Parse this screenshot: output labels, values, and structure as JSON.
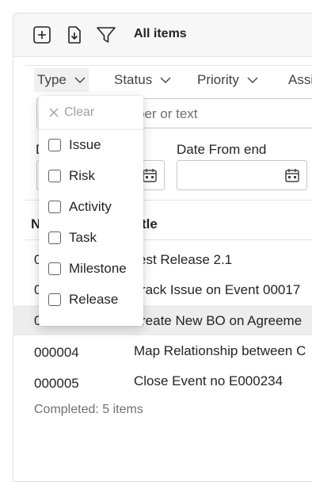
{
  "toolbar": {
    "title": "All items",
    "icons": [
      "add-icon",
      "import-icon",
      "filter-icon"
    ]
  },
  "filters": {
    "chips": [
      "Type",
      "Status",
      "Priority",
      "Assi"
    ],
    "search_placeholder": "ber or text",
    "date_from_start_label": "D",
    "date_from_end_label": "Date From end"
  },
  "table": {
    "headers": {
      "number": "N",
      "title": "tle"
    },
    "rows": [
      {
        "number": "0",
        "title": "est Release 2.1"
      },
      {
        "number": "0",
        "title": "rack Issue on Event 00017"
      },
      {
        "number": "0",
        "title": "reate New BO on Agreeme"
      },
      {
        "number": "000004",
        "title": "Map Relationship between C"
      },
      {
        "number": "000005",
        "title": "Close Event no E000234"
      }
    ],
    "footer": "Completed: 5 items"
  },
  "type_dropdown": {
    "clear_label": "Clear",
    "options": [
      "Issue",
      "Risk",
      "Activity",
      "Task",
      "Milestone",
      "Release"
    ]
  }
}
